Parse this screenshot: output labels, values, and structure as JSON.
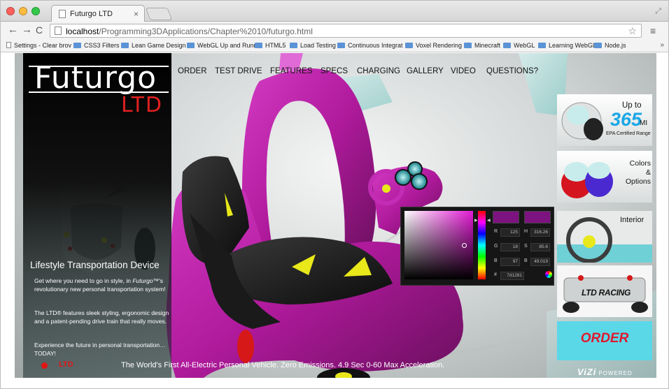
{
  "browser": {
    "tab_title": "Futurgo LTD",
    "tab_close": "×",
    "url_host": "localhost",
    "url_path": "/Programming3DApplications/Chapter%2010/futurgo.html",
    "back": "←",
    "forward": "→",
    "reload": "C",
    "star": "☆",
    "menu": "≡",
    "bookmarks_more": "»",
    "bookmarks": [
      {
        "label": "Settings - Clear brov",
        "kind": "page"
      },
      {
        "label": "CSS3 Filters",
        "kind": "folder"
      },
      {
        "label": "Lean Game Design w",
        "kind": "folder"
      },
      {
        "label": "WebGL Up and Runn",
        "kind": "folder"
      },
      {
        "label": "HTML5",
        "kind": "folder"
      },
      {
        "label": "Load Testing",
        "kind": "folder"
      },
      {
        "label": "Continuous Integrat",
        "kind": "folder"
      },
      {
        "label": "Voxel Rendering",
        "kind": "folder"
      },
      {
        "label": "Minecraft",
        "kind": "folder"
      },
      {
        "label": "WebGL",
        "kind": "folder"
      },
      {
        "label": "Learning WebGL",
        "kind": "folder"
      },
      {
        "label": "Node.js",
        "kind": "folder"
      }
    ]
  },
  "site": {
    "logo": "Futurgo",
    "logo_sub": "LTD",
    "nav": [
      "ORDER",
      "TEST DRIVE",
      "FEATURES",
      "SPECS",
      "CHARGING",
      "GALLERY",
      "VIDEO",
      "QUESTIONS?"
    ],
    "tagline": "Lifestyle Transportation Device",
    "para1_a": "Get where you need to go in style, in ",
    "para1_brand": "Futurgo",
    "para1_b": "™'s revolutionary new personal transportation system!",
    "para2": "The LTD® features sleek styling, ergonomic design and a patent-pending drive train that really moves.",
    "para3": "Experience the future in personal transportation… TODAY!",
    "ltd_label": "LTD",
    "bottom_text": "The World's First All-Electric Personal Vehicle. Zero Emissions. 4.9 Sec 0-60 Max Acceleration.",
    "vizi": "ViZi",
    "vizi_powered": "POWERED"
  },
  "tiles": {
    "range_upto": "Up to",
    "range_value": "365",
    "range_unit": "MI",
    "range_caption": "EPA Certified Range",
    "colors": "Colors\n&\nOptions",
    "interior": "Interior",
    "racing": "LTD RACING",
    "order": "ORDER"
  },
  "color_picker": {
    "current_color": "#7d1281",
    "previous_color": "#7d1281",
    "fields": [
      {
        "label": "R",
        "value": "125"
      },
      {
        "label": "H",
        "value": "316.26"
      },
      {
        "label": "G",
        "value": "18"
      },
      {
        "label": "S",
        "value": "85.6"
      },
      {
        "label": "B",
        "value": "97"
      },
      {
        "label": "B",
        "value": "49.019"
      }
    ],
    "hex_label": "#",
    "hex": "7d1281"
  },
  "colors": {
    "accent_red": "#e01616",
    "car_magenta": "#b01a9c",
    "order_tile": "#5ad8e8",
    "range_blue": "#1aa7e6"
  }
}
